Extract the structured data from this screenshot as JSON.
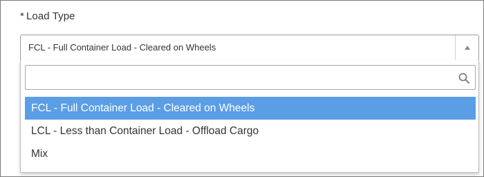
{
  "field": {
    "required_marker": "*",
    "label": "Load Type",
    "selected_value": "FCL - Full Container Load - Cleared on Wheels"
  },
  "dropdown": {
    "search": {
      "value": "",
      "placeholder": "",
      "icon": "search-icon"
    },
    "options": [
      {
        "label": "FCL - Full Container Load - Cleared on Wheels",
        "selected": true
      },
      {
        "label": "LCL - Less than Container Load - Offload Cargo",
        "selected": false
      },
      {
        "label": "Mix",
        "selected": false
      }
    ],
    "arrow_icon": "chevron-up-icon"
  },
  "colors": {
    "highlight": "#5b9ee6",
    "text": "#333333",
    "border": "#9a9a9a"
  }
}
